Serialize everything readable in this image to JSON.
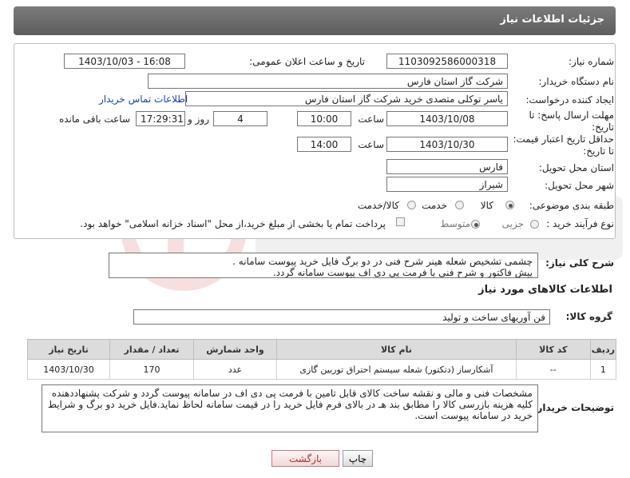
{
  "header": {
    "title": "جزئیات اطلاعات نیاز"
  },
  "need": {
    "number_label": "شماره نیاز:",
    "number": "1103092586000318",
    "announce_label": "تاریخ و ساعت اعلان عمومی:",
    "announce_value": "1403/10/03 - 16:08",
    "buyer_label": "نام دستگاه خریدار:",
    "buyer": "شرکت گاز استان فارس",
    "creator_label": "ایجاد کننده درخواست:",
    "creator": "یاسر توکلی متصدی خرید شرکت گاز استان فارس",
    "contact_link": "اطلاعات تماس خریدار",
    "deadline_label": "مهلت ارسال پاسخ: تا تاریخ:",
    "deadline_date": "1403/10/08",
    "time_label": "ساعت",
    "deadline_time": "10:00",
    "days": "4",
    "days_label": "روز و",
    "remaining_time": "17:29:31",
    "remaining_label": "ساعت باقی مانده",
    "validity_label": "حداقل تاریخ اعتبار قیمت: تا تاریخ:",
    "validity_date": "1403/10/30",
    "validity_time": "14:00",
    "province_label": "استان محل تحویل:",
    "province": "فارس",
    "city_label": "شهر محل تحویل:",
    "city": "شیراز",
    "category_label": "طبقه بندی موضوعی:",
    "category_options": [
      "کالا",
      "خدمت",
      "کالا/خدمت"
    ],
    "process_label": "نوع فرآیند خرید :",
    "process_options": [
      "جزیی",
      "متوسط"
    ],
    "payment_note": "پرداخت تمام یا بخشی از مبلغ خرید،از محل \"اسناد خزانه اسلامی\" خواهد بود."
  },
  "summary": {
    "label": "شرح کلی نیاز:",
    "text": "چشمی تشخیص شعله هینر شرح فنی در دو برگ فایل خرید پیوست سامانه .\nپیش فاکتور و شرح فنی با فرمت پی دی اف پیوست سامانه گردد."
  },
  "goods": {
    "section_title": "اطلاعات کالاهای مورد نیاز",
    "group_label": "گروه کالا:",
    "group": "فن آوریهای ساخت و تولید",
    "columns": [
      "ردیف",
      "کد کالا",
      "نام کالا",
      "واحد شمارش",
      "تعداد / مقدار",
      "تاریخ نیاز"
    ],
    "rows": [
      [
        "1",
        "--",
        "آشکارساز (دتکتور) شعله سیستم احتراق توربین گازی",
        "عدد",
        "170",
        "1403/10/30"
      ]
    ]
  },
  "buyer_notes": {
    "label": "توضیحات خریدار:",
    "text": "مشخصات فنی و  مالی و نقشه ساخت  کالای قابل تامین  با فرمت پی دی اف در سامانه پیوست گردد و شرکت پشنهاددهنده کلیه هزینه بازرسی کالا را مطابق بند هـ در بالای فرم فایل خرید را در قیمت سامانه لحاظ نماید.فایل خرید دو برگ و شرایط خرید در سامانه پیوست است."
  },
  "buttons": {
    "print": "چاپ",
    "back": "بازگشت"
  },
  "colors": {
    "header_bg": "#6b6b6b",
    "link": "#1a3fb5",
    "table_header": "#dcdcdc",
    "back_button_text": "#a33333"
  }
}
